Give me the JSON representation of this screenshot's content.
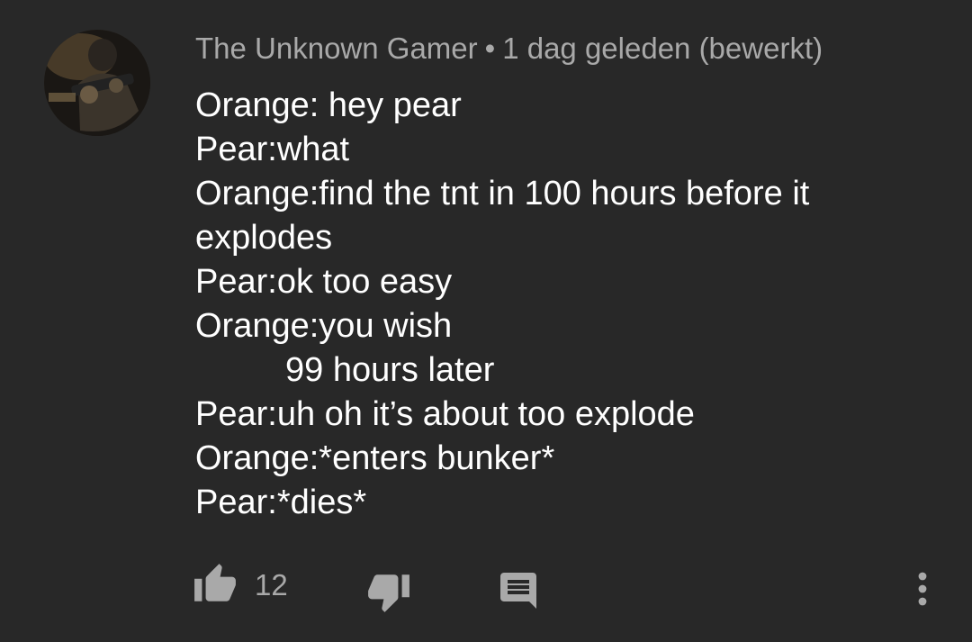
{
  "comment": {
    "author": "The Unknown Gamer",
    "separator": "•",
    "timestamp": "1 dag geleden (bewerkt)",
    "lines": [
      "Orange: hey pear",
      "Pear:what",
      "Orange:find the tnt in 100 hours before it",
      "explodes",
      "Pear:ok too easy",
      "Orange:you wish",
      "99 hours later",
      "Pear:uh oh it’s about too explode",
      "Orange:*enters bunker*",
      "Pear:*dies*"
    ],
    "like_count": "12"
  },
  "icons": {
    "like": "thumbs-up-icon",
    "dislike": "thumbs-down-icon",
    "reply": "comment-reply-icon",
    "more": "more-vertical-icon"
  },
  "colors": {
    "background": "#282828",
    "text": "#ffffff",
    "meta_text": "#a9a9a9",
    "icon": "#a9a9a9"
  }
}
